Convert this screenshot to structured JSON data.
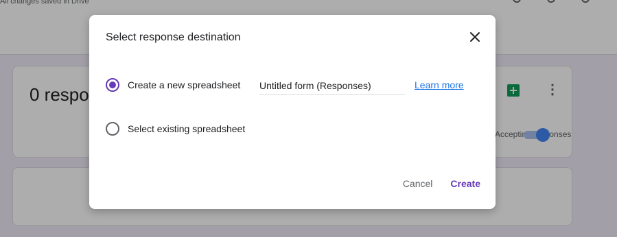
{
  "topbar": {
    "saved_text": "All changes saved in Drive"
  },
  "card": {
    "response_count": "0 responses",
    "accepting_label": "Accepting responses",
    "accepting_toggle_on": true
  },
  "dialog": {
    "title": "Select response destination",
    "options": [
      {
        "label": "Create a new spreadsheet",
        "selected": true
      },
      {
        "label": "Select existing spreadsheet",
        "selected": false
      }
    ],
    "spreadsheet_name": "Untitled form (Responses)",
    "learn_more": "Learn more",
    "cancel_label": "Cancel",
    "create_label": "Create",
    "accent_color": "#673ab7",
    "link_color": "#1a73e8"
  }
}
